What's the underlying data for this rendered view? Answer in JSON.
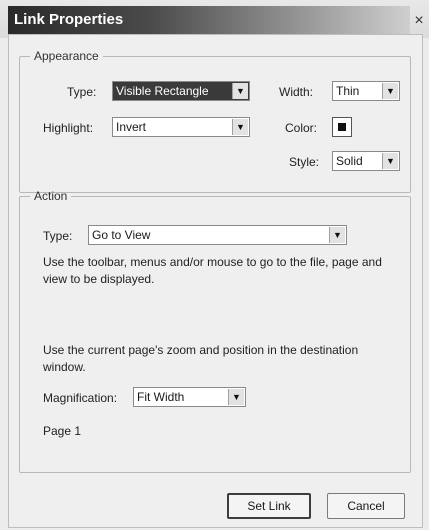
{
  "window": {
    "title": "Link Properties",
    "close_glyph": "×"
  },
  "appearance": {
    "legend": "Appearance",
    "type_label": "Type:",
    "type_value": "Visible Rectangle",
    "highlight_label": "Highlight:",
    "highlight_value": "Invert",
    "width_label": "Width:",
    "width_value": "Thin",
    "color_label": "Color:",
    "color_value": "#111111",
    "style_label": "Style:",
    "style_value": "Solid"
  },
  "action": {
    "legend": "Action",
    "type_label": "Type:",
    "type_value": "Go to View",
    "instructions": "Use the toolbar, menus and/or mouse to go to the file, page and view to be displayed.",
    "zoom_note": "Use the current page's zoom and position in the destination window.",
    "magnification_label": "Magnification:",
    "magnification_value": "Fit Width",
    "page_label": "Page 1"
  },
  "buttons": {
    "set_link": "Set Link",
    "cancel": "Cancel"
  },
  "icons": {
    "dropdown": "chevron-down-icon",
    "close": "close-icon"
  }
}
